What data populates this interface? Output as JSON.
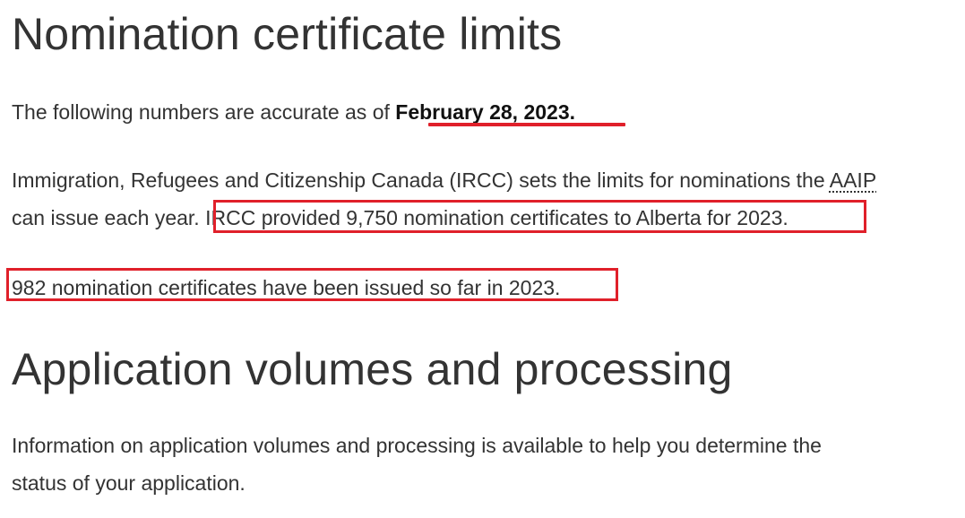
{
  "section1": {
    "heading": "Nomination certificate limits",
    "accuracy_prefix": "The following numbers are accurate as of ",
    "accuracy_date": "February 28, 2023",
    "accuracy_suffix": ".",
    "limits_line1_text": "Immigration, Refugees and Citizenship Canada (IRCC) sets the limits for nominations the ",
    "limits_line1_abbr": "AAIP",
    "limits_line2_text": "can issue each year.",
    "limits_highlight": " IRCC provided 9,750 nomination certificates to Alberta for 2023.",
    "issued_text": "982 nomination certificates have been issued so far in 2023."
  },
  "section2": {
    "heading": "Application volumes and processing",
    "info_line1": "Information on application volumes and processing is available to help you determine the",
    "info_line2": "status of your application."
  },
  "annotation_color": "#e0202a"
}
